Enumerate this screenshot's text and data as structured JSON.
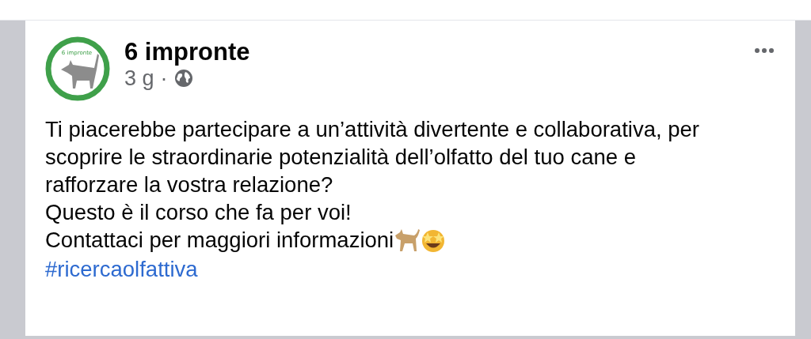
{
  "post": {
    "author": "6 impronte",
    "avatar_text": "6 impronte",
    "time": "3 g",
    "separator": "·",
    "paragraphs": [
      "Ti piacerebbe partecipare a un’attività divertente e collaborativa, per scoprire le straordinarie potenzialità dell’olfatto del tuo cane e rafforzare la vostra relazione?",
      "Questo è il corso che fa per voi!",
      "Contattaci per maggiori informazioni"
    ],
    "hashtag": "#ricercaolfattiva"
  }
}
